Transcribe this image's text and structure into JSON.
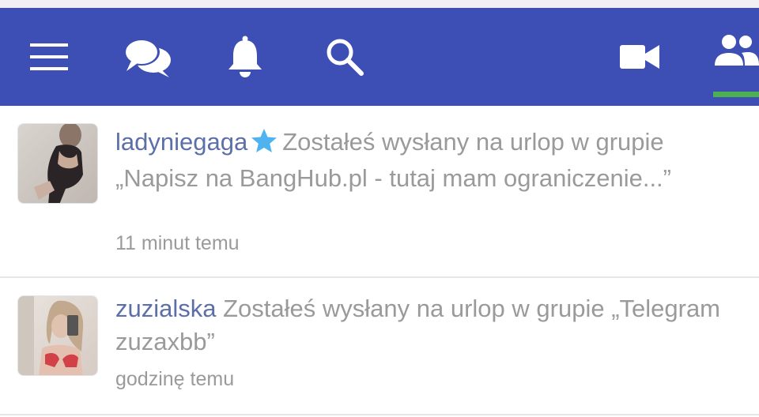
{
  "topbar": {
    "color": "#3d4fb5",
    "active_indicator_color": "#4caf50",
    "icons": [
      "menu-icon",
      "chat-icon",
      "bell-icon",
      "search-icon",
      "video-icon",
      "friends-icon"
    ],
    "active_tab": "friends-icon"
  },
  "notifications": [
    {
      "username": "ladyniegaga",
      "has_star": true,
      "message": "Zostałeś wysłany na urlop w grupie „Napisz na BangHub.pl - tutaj mam ograniczenie...”",
      "time": "11 minut temu"
    },
    {
      "username": "zuzialska",
      "has_star": false,
      "message": "Zostałeś wysłany na urlop w grupie „Telegram zuzaxbb”",
      "time": "godzinę temu"
    }
  ],
  "colors": {
    "username": "#5c6fa8",
    "message": "#9a9a9a",
    "star": "#4fb3f0"
  }
}
